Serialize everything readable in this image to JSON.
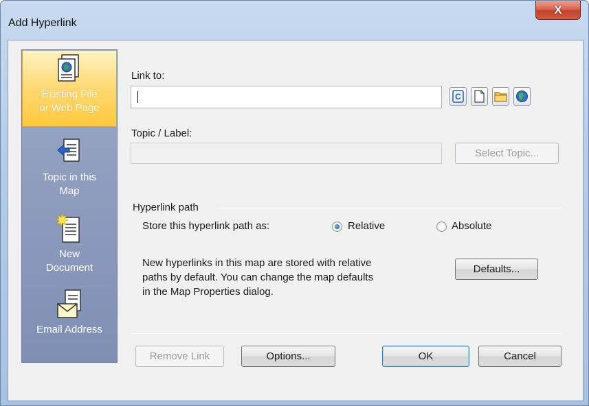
{
  "window": {
    "title": "Add Hyperlink",
    "close_glyph": "X"
  },
  "sidebar": {
    "items": [
      {
        "label_line1": "Existing File",
        "label_line2": "or Web Page",
        "icon": "document-globe-icon",
        "active": true
      },
      {
        "label_line1": "Topic in this",
        "label_line2": "Map",
        "icon": "topic-arrow-icon",
        "active": false
      },
      {
        "label_line1": "New",
        "label_line2": "Document",
        "icon": "new-document-icon",
        "active": false
      },
      {
        "label_line1": "Email Address",
        "label_line2": "",
        "icon": "envelope-icon",
        "active": false
      }
    ]
  },
  "link_to": {
    "label": "Link to:",
    "value": "",
    "tools": [
      "copy-link-icon",
      "file-icon",
      "folder-icon",
      "globe-icon"
    ]
  },
  "topic_label": {
    "label": "Topic / Label:",
    "value": "",
    "select_button": "Select Topic..."
  },
  "hyperlink_path": {
    "group_label": "Hyperlink path",
    "store_label": "Store this hyperlink path as:",
    "options": [
      {
        "label": "Relative",
        "checked": true
      },
      {
        "label": "Absolute",
        "checked": false
      }
    ],
    "info_lines": [
      "New hyperlinks in this map are stored with relative",
      "paths by default. You can change the map defaults",
      "in the Map Properties dialog."
    ],
    "defaults_button": "Defaults..."
  },
  "footer": {
    "remove_link": "Remove Link",
    "options": "Options...",
    "ok": "OK",
    "cancel": "Cancel"
  }
}
